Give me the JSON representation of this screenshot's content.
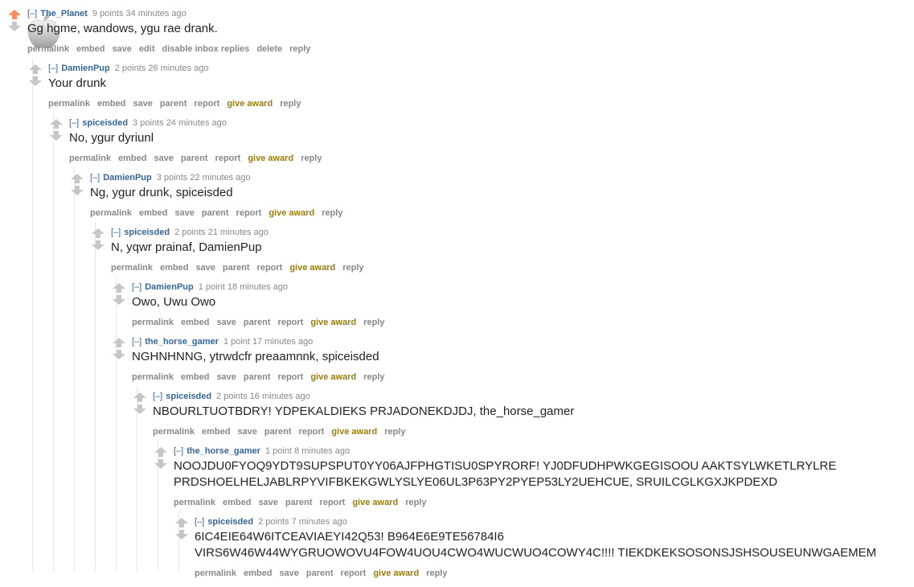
{
  "comments": [
    {
      "author": "The_Planet",
      "points": "9 points",
      "time": "34 minutes ago",
      "body": [
        "Gg hgme, wandows, ygu rae drank."
      ],
      "upvoted": true,
      "buttons": [
        "permalink",
        "embed",
        "save",
        "edit",
        "disable inbox replies",
        "delete",
        "reply"
      ]
    },
    {
      "author": "DamienPup",
      "points": "2 points",
      "time": "26 minutes ago",
      "body": [
        "Your drunk"
      ],
      "buttons": [
        "permalink",
        "embed",
        "save",
        "parent",
        "report",
        "give award",
        "reply"
      ]
    },
    {
      "author": "spiceisded",
      "points": "3 points",
      "time": "24 minutes ago",
      "body": [
        "No, ygur dyriunl"
      ],
      "buttons": [
        "permalink",
        "embed",
        "save",
        "parent",
        "report",
        "give award",
        "reply"
      ]
    },
    {
      "author": "DamienPup",
      "points": "3 points",
      "time": "22 minutes ago",
      "body": [
        "Ng, ygur drunk, spiceisded"
      ],
      "buttons": [
        "permalink",
        "embed",
        "save",
        "parent",
        "report",
        "give award",
        "reply"
      ]
    },
    {
      "author": "spiceisded",
      "points": "2 points",
      "time": "21 minutes ago",
      "body": [
        "N, yqwr prainaf, DamienPup"
      ],
      "buttons": [
        "permalink",
        "embed",
        "save",
        "parent",
        "report",
        "give award",
        "reply"
      ]
    },
    {
      "author": "DamienPup",
      "points": "1 point",
      "time": "18 minutes ago",
      "body": [
        "Owo, Uwu Owo"
      ],
      "buttons": [
        "permalink",
        "embed",
        "save",
        "parent",
        "report",
        "give award",
        "reply"
      ]
    },
    {
      "author": "the_horse_gamer",
      "points": "1 point",
      "time": "17 minutes ago",
      "body": [
        "NGHNHNNG, ytrwdcfr preaamnnk, spiceisded"
      ],
      "buttons": [
        "permalink",
        "embed",
        "save",
        "parent",
        "report",
        "give award",
        "reply"
      ]
    },
    {
      "author": "spiceisded",
      "points": "2 points",
      "time": "16 minutes ago",
      "body": [
        "NBOURLTUOTBDRY! YDPEKALDIEKS PRJADONEKDJDJ, the_horse_gamer"
      ],
      "buttons": [
        "permalink",
        "embed",
        "save",
        "parent",
        "report",
        "give award",
        "reply"
      ]
    },
    {
      "author": "the_horse_gamer",
      "points": "1 point",
      "time": "8 minutes ago",
      "body": [
        "NOOJDU0FYOQ9YDT9SUPSPUT0YY06AJFPHGTISU0SPYRORF! YJ0DFUDHPWKGEGISOOU AAKTSYLWKETLRYLRE",
        "PRDSHOELHELJABLRPYVIFBKEKGWLYSLYE06UL3P63PY2PYEP53LY2UEHCUE, SRUILCGLKGXJKPDEXD"
      ],
      "buttons": [
        "permalink",
        "embed",
        "save",
        "parent",
        "report",
        "give award",
        "reply"
      ]
    },
    {
      "author": "spiceisded",
      "points": "2 points",
      "time": "7 minutes ago",
      "body": [
        "6IC4EIE64W6ITCEAVIAEYI42Q53! B964E6E9TE56784I6",
        "VIRS6W46W44WYGRUOWOVU4FOW4UOU4CWO4WUCWUO4COWY4C!!!! TIEKDKEKSOSONSJSHSOUSEUNWGAEMEM"
      ],
      "buttons": [
        "permalink",
        "embed",
        "save",
        "parent",
        "report",
        "give award",
        "reply"
      ]
    }
  ]
}
